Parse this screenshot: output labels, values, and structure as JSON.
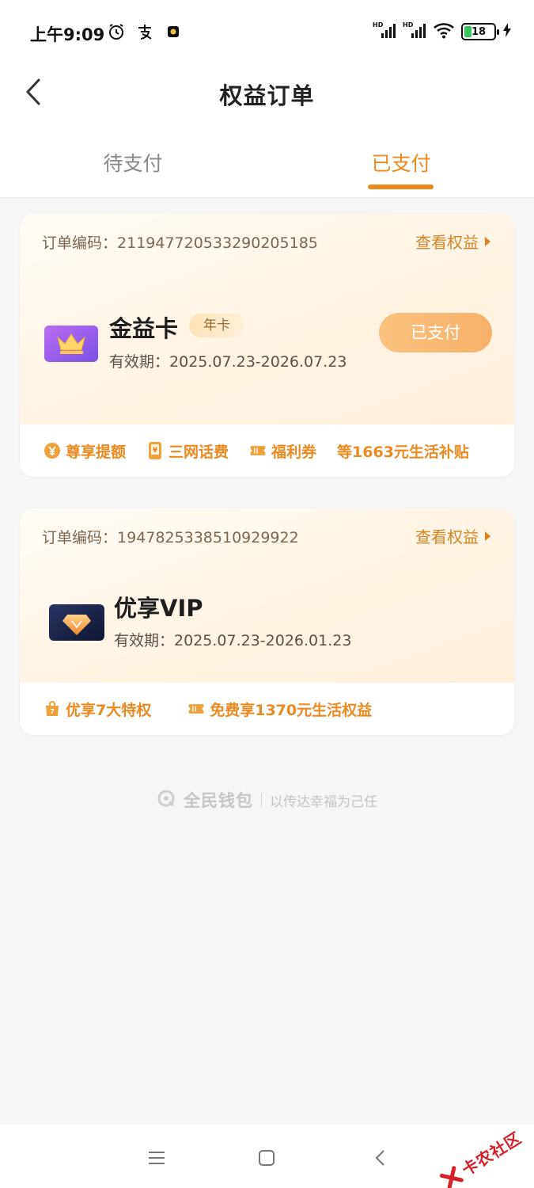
{
  "status_bar": {
    "time": "上午9:09",
    "left_icons": [
      "alarm-icon",
      "alipay-icon",
      "app-notification-icon"
    ],
    "signal_labels": [
      "HD",
      "HD"
    ],
    "battery_level": "18",
    "battery_percent": 18
  },
  "header": {
    "title": "权益订单",
    "back_icon": "chevron-left-icon"
  },
  "tabs": [
    {
      "label": "待支付",
      "active": false
    },
    {
      "label": "已支付",
      "active": true
    }
  ],
  "orders": [
    {
      "order_label": "订单编码：",
      "order_no": "211947720533290205185",
      "view_link": "查看权益",
      "product_name": "金益卡",
      "badge": "年卡",
      "validity_label": "有效期：",
      "validity": "2025.07.23-2026.07.23",
      "status_button": "已支付",
      "benefits": [
        {
          "icon": "yuan-up-icon",
          "label": "尊享提额"
        },
        {
          "icon": "phone-bill-icon",
          "label": "三网话费"
        },
        {
          "icon": "coupon-icon",
          "label": "福利券"
        },
        {
          "icon": "",
          "label": "等1663元生活补贴"
        }
      ]
    },
    {
      "order_label": "订单编码：",
      "order_no": "1947825338510929922",
      "view_link": "查看权益",
      "product_name": "优享VIP",
      "validity_label": "有效期：",
      "validity": "2025.07.23-2026.01.23",
      "benefits": [
        {
          "icon": "gift-bag-icon",
          "label": "优享7大特权"
        },
        {
          "icon": "coupon-icon",
          "label": "免费享1370元生活权益"
        }
      ]
    }
  ],
  "footer": {
    "brand": "全民钱包",
    "slogan": "以传达幸福为己任"
  },
  "watermark": {
    "text": "卡农社区"
  },
  "colors": {
    "accent": "#ec8a1e",
    "paid_button": "#f8b06a",
    "card_gradient": "#fff3e2",
    "page_bg": "#f6f6f7"
  }
}
